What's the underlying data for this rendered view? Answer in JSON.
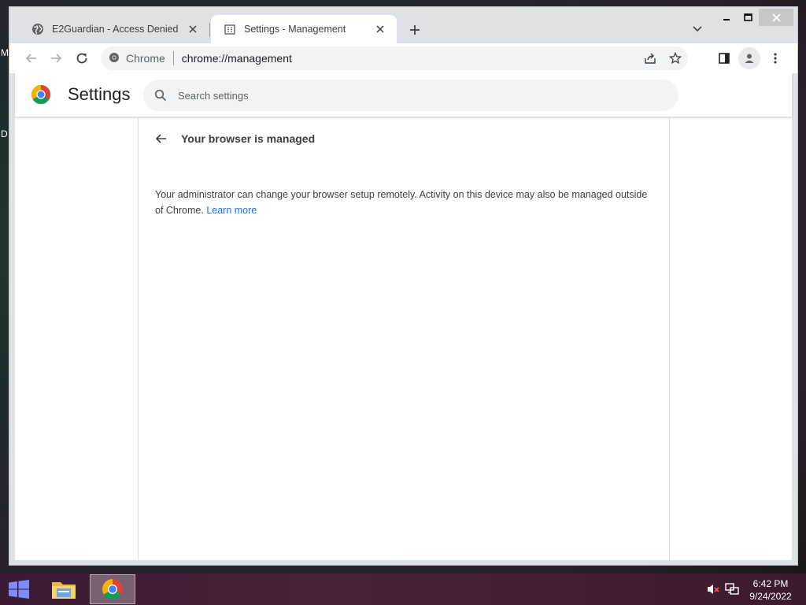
{
  "desktop": {
    "edge_letters": [
      "M",
      "D"
    ]
  },
  "tabs": [
    {
      "title": "E2Guardian - Access Denied",
      "icon": "globe-icon",
      "active": false
    },
    {
      "title": "Settings - Management",
      "icon": "settings-page-icon",
      "active": true
    }
  ],
  "toolbar": {
    "omnibox_label": "Chrome",
    "url": "chrome://management"
  },
  "settings": {
    "title": "Settings",
    "search_placeholder": "Search settings"
  },
  "management": {
    "heading": "Your browser is managed",
    "description": "Your administrator can change your browser setup remotely. Activity on this device may also be managed outside of Chrome.",
    "learn_more": "Learn more"
  },
  "taskbar": {
    "time": "6:42 PM",
    "date": "9/24/2022",
    "pinned": [
      "file-explorer-icon",
      "chrome-icon"
    ],
    "tray": [
      "volume-muted-icon",
      "network-icon"
    ]
  },
  "colors": {
    "accent_blue": "#1a73e8",
    "tabstrip_bg": "#dee1e6",
    "omnibox_bg": "#f1f3f4"
  }
}
